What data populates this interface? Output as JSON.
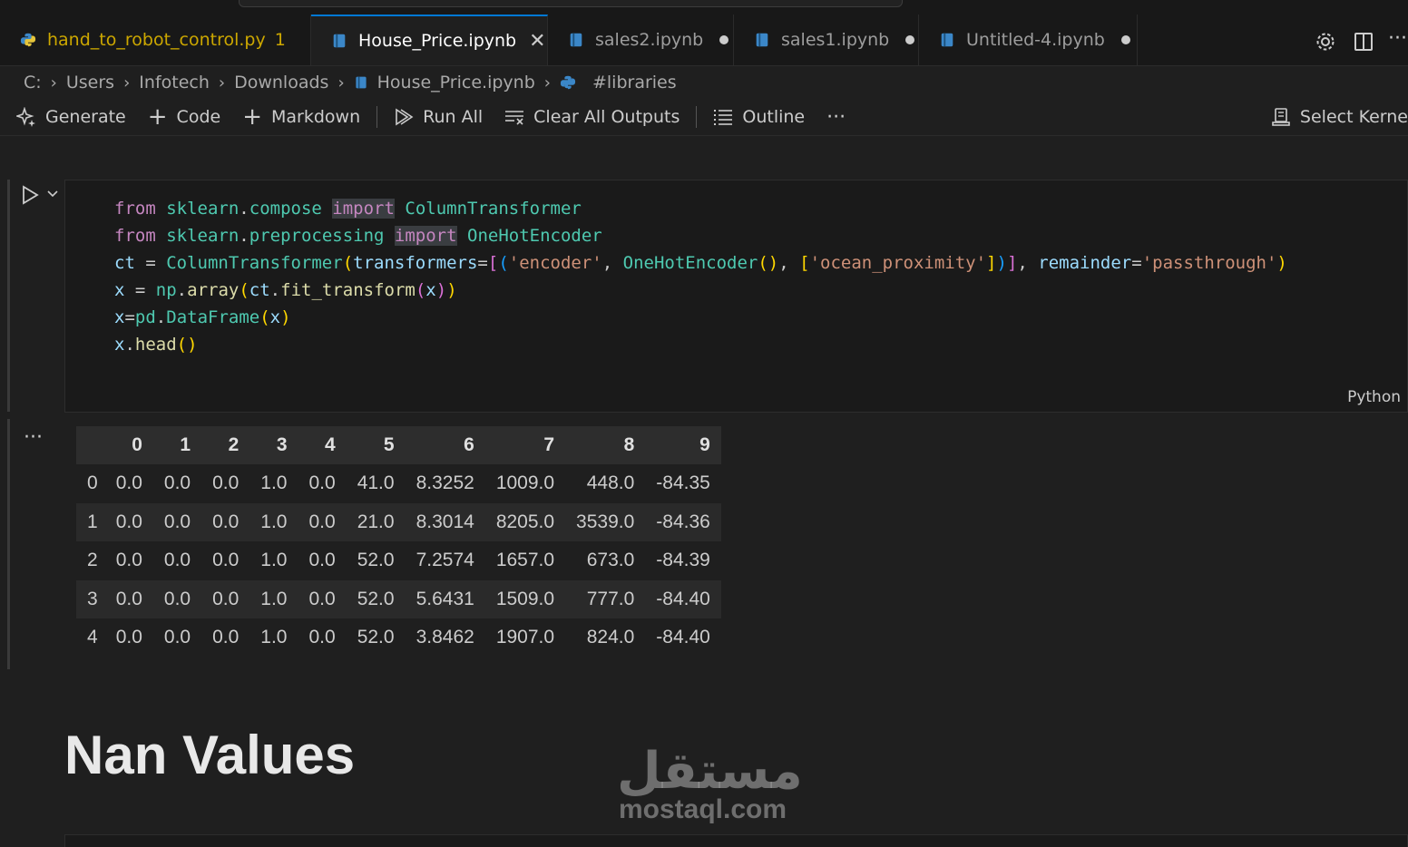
{
  "tabs": [
    {
      "label": "hand_to_robot_control.py",
      "badge": "1"
    },
    {
      "label": "House_Price.ipynb",
      "close": "✕"
    },
    {
      "label": "sales2.ipynb"
    },
    {
      "label": "sales1.ipynb"
    },
    {
      "label": "Untitled-4.ipynb"
    }
  ],
  "breadcrumb": [
    "C:",
    "Users",
    "Infotech",
    "Downloads",
    "House_Price.ipynb",
    "#libraries"
  ],
  "toolbar": {
    "generate": "Generate",
    "code": "Code",
    "markdown": "Markdown",
    "run_all": "Run All",
    "clear_all_outputs": "Clear All Outputs",
    "outline": "Outline",
    "more": "···",
    "select_kernel": "Select Kerne"
  },
  "code": {
    "line1": {
      "a": "from",
      "b": "sklearn",
      "c": ".",
      "d": "compose",
      "e": "import",
      "f": "ColumnTransformer"
    },
    "line2": {
      "a": "from",
      "b": "sklearn",
      "c": ".",
      "d": "preprocessing",
      "e": "import",
      "f": "OneHotEncoder"
    },
    "line3": {
      "v1": "ct",
      "eq": " = ",
      "c1": "ColumnTransformer",
      "p1": "(",
      "k1": "transformers",
      "eq2": "=",
      "p2": "[",
      "p3": "(",
      "s1": "'encoder'",
      "cm": ", ",
      "c2": "OneHotEncoder",
      "p4": "()",
      "cm2": ", ",
      "p5": "[",
      "s2": "'ocean_proximity'",
      "p6": "]",
      "p7": ")",
      "p8": "]",
      "cm3": ", ",
      "k2": "remainder",
      "eq3": "=",
      "s3": "'passthrough'",
      "p9": ")"
    },
    "line4": {
      "v1": "x",
      "eq": " = ",
      "m": "np",
      "dot": ".",
      "f": "array",
      "p1": "(",
      "v2": "ct",
      "dot2": ".",
      "f2": "fit_transform",
      "p2": "(",
      "v3": "x",
      "p3": ")",
      "p4": ")"
    },
    "line5": {
      "v1": "x",
      "eq": "=",
      "m": "pd",
      "dot": ".",
      "c": "DataFrame",
      "p1": "(",
      "v2": "x",
      "p2": ")"
    },
    "line6": {
      "v1": "x",
      "dot": ".",
      "f": "head",
      "p": "()"
    },
    "language": "Python"
  },
  "output": {
    "more": "···",
    "columns": [
      "",
      "0",
      "1",
      "2",
      "3",
      "4",
      "5",
      "6",
      "7",
      "8",
      "9"
    ],
    "rows": [
      [
        "0",
        "0.0",
        "0.0",
        "0.0",
        "1.0",
        "0.0",
        "41.0",
        "8.3252",
        "1009.0",
        "448.0",
        "-84.35"
      ],
      [
        "1",
        "0.0",
        "0.0",
        "0.0",
        "1.0",
        "0.0",
        "21.0",
        "8.3014",
        "8205.0",
        "3539.0",
        "-84.36"
      ],
      [
        "2",
        "0.0",
        "0.0",
        "0.0",
        "1.0",
        "0.0",
        "52.0",
        "7.2574",
        "1657.0",
        "673.0",
        "-84.39"
      ],
      [
        "3",
        "0.0",
        "0.0",
        "0.0",
        "1.0",
        "0.0",
        "52.0",
        "5.6431",
        "1509.0",
        "777.0",
        "-84.40"
      ],
      [
        "4",
        "0.0",
        "0.0",
        "0.0",
        "1.0",
        "0.0",
        "52.0",
        "3.8462",
        "1907.0",
        "824.0",
        "-84.40"
      ]
    ]
  },
  "markdown": {
    "heading": "Nan Values"
  },
  "watermark": {
    "arabic": "مستقل",
    "latin": "mostaql.com"
  },
  "colors": {
    "accent": "#0078d4",
    "background": "#1f1f1f"
  }
}
